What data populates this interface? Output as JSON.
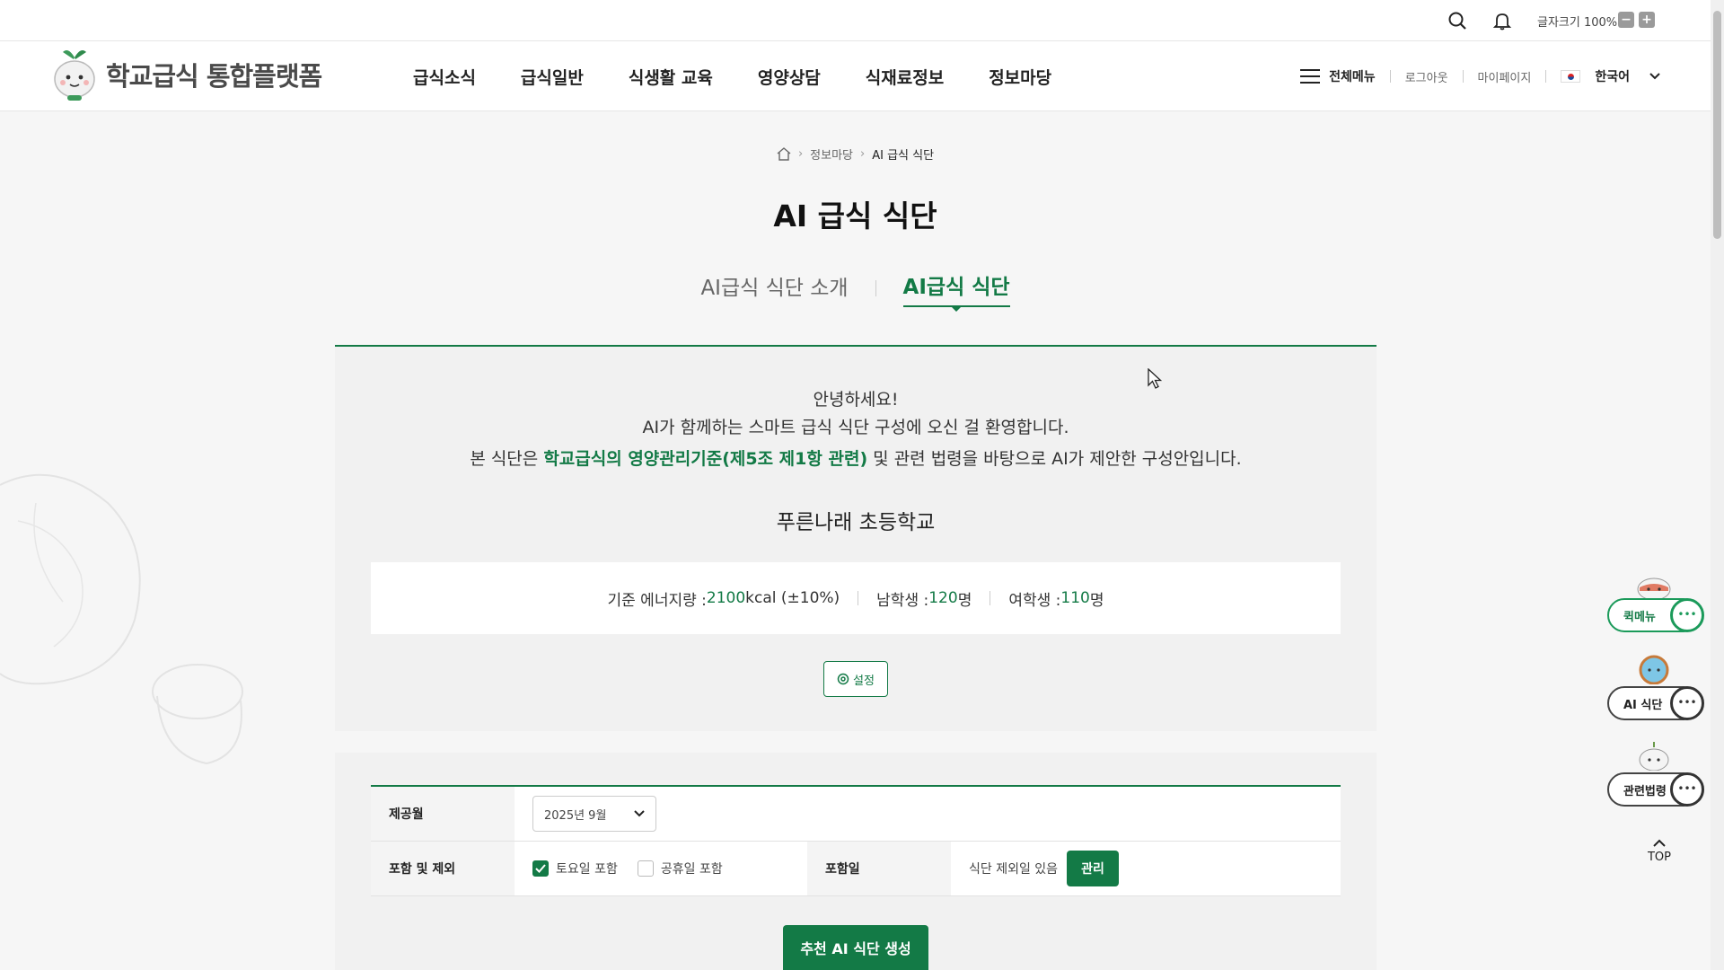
{
  "utility": {
    "font_size_label": "글자크기 100%",
    "decrease": "−",
    "increase": "+"
  },
  "header": {
    "logo_text": "학교급식 통합플랫폼",
    "nav": [
      "급식소식",
      "급식일반",
      "식생활 교육",
      "영양상담",
      "식재료정보",
      "정보마당"
    ],
    "all_menu": "전체메뉴",
    "logout": "로그아웃",
    "mypage": "마이페이지",
    "language": "한국어"
  },
  "breadcrumb": {
    "parent": "정보마당",
    "current": "AI 급식 식단"
  },
  "page_title": "AI 급식 식단",
  "tabs": [
    "AI급식 식단 소개",
    "AI급식 식단"
  ],
  "intro": {
    "greeting_1": "안녕하세요!",
    "greeting_2": "AI가 함께하는 스마트 급식 식단 구성에 오신 걸 환영합니다.",
    "basis_pre": "본 식단은 ",
    "basis_highlight": "학교급식의 영양관리기준(제5조 제1항 관련)",
    "basis_post": " 및 관련 법령을 바탕으로 AI가 제안한 구성안입니다.",
    "school_name": "푸른나래 초등학교",
    "energy_label": "기준 에너지량 : ",
    "energy_value": "2100",
    "energy_unit": " kcal (±10%)",
    "male_label": "남학생 : ",
    "male_value": "120",
    "male_unit": " 명",
    "female_label": "여학생 : ",
    "female_value": "110",
    "female_unit": " 명",
    "settings_label": "설정"
  },
  "form": {
    "month_label": "제공월",
    "month_value": "2025년 9월",
    "include_label": "포함 및 제외",
    "saturday_label": "토요일 포함",
    "saturday_checked": true,
    "holiday_label": "공휴일 포함",
    "holiday_checked": false,
    "include_day_label": "포함일",
    "exclude_text": "식단 제외일 있음",
    "manage_label": "관리",
    "generate_label": "추천 AI 식단 생성"
  },
  "floating": {
    "quick_menu": "퀵메뉴",
    "ai_menu": "AI 식단",
    "laws": "관련법령",
    "dots": "•••",
    "top": "TOP"
  },
  "colors": {
    "accent": "#137a46",
    "panel": "#f1f1f1"
  }
}
